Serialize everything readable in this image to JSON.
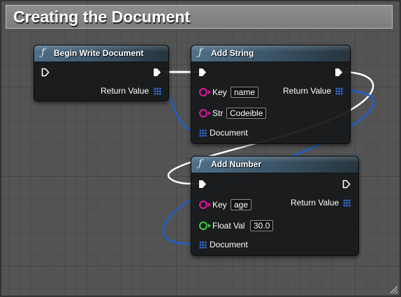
{
  "comment": {
    "title": "Creating the Document"
  },
  "nodes": {
    "begin_write": {
      "icon": "function-icon",
      "title": "Begin Write Document",
      "outputs": {
        "return_label": "Return Value"
      }
    },
    "add_string": {
      "icon": "function-icon",
      "title": "Add String",
      "inputs": {
        "key_label": "Key",
        "key_value": "name",
        "str_label": "Str",
        "str_value": "Codeible",
        "document_label": "Document"
      },
      "outputs": {
        "return_label": "Return Value"
      }
    },
    "add_number": {
      "icon": "function-icon",
      "title": "Add Number",
      "inputs": {
        "key_label": "Key",
        "key_value": "age",
        "float_label": "Float Val",
        "float_value": "30.0",
        "document_label": "Document"
      },
      "outputs": {
        "return_label": "Return Value"
      }
    }
  },
  "colors": {
    "string_pin": "#e0189e",
    "float_pin": "#3dd43d",
    "struct_pin": "#2e6fe0",
    "exec_wire": "#ffffff",
    "struct_wire": "#1f5fd0"
  }
}
